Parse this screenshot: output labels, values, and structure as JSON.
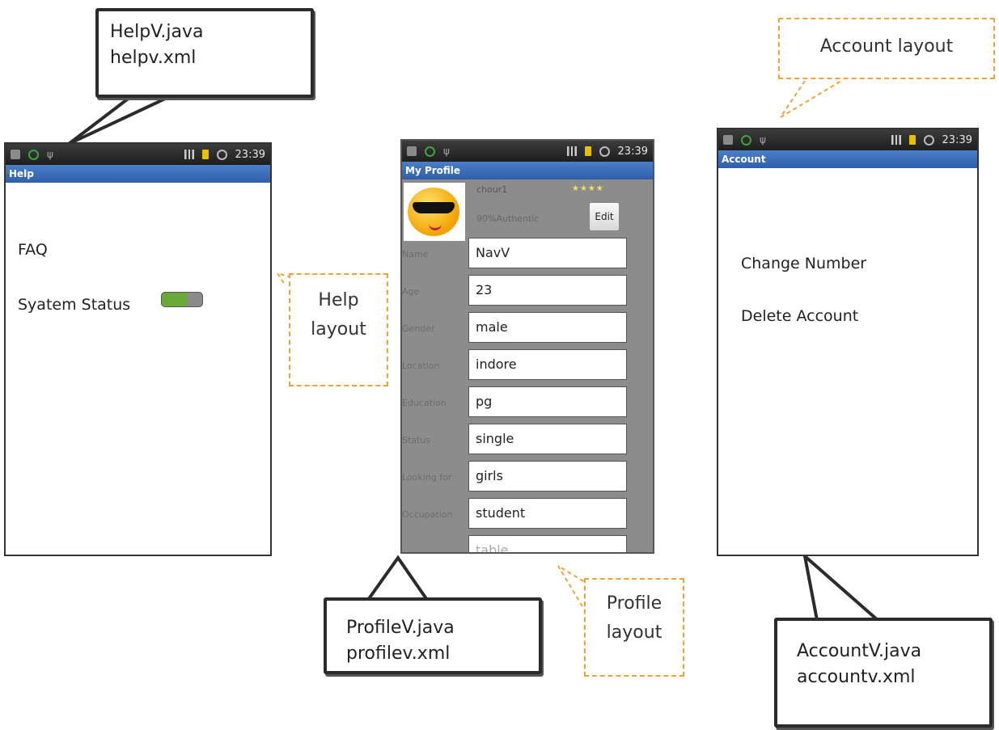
{
  "callouts": {
    "help": [
      "HelpV.java",
      "helpv.xml"
    ],
    "profile": [
      "ProfileV.java",
      "profilev.xml"
    ],
    "account": [
      "AccountV.java",
      "accountv.xml"
    ]
  },
  "notes": {
    "help": [
      "Help",
      "layout"
    ],
    "profile": [
      "Profile",
      "layout"
    ],
    "account": "Account layout"
  },
  "statusbar": {
    "time": "23:39"
  },
  "help_screen": {
    "title": "Help",
    "items": [
      "FAQ",
      "Syatem Status"
    ]
  },
  "profile_screen": {
    "title": "My Profile",
    "user": "chour1",
    "authenticity": "90%Authentic",
    "stars": "★★★★",
    "edit_label": "Edit",
    "fields": [
      {
        "label": "Name",
        "value": "NavV"
      },
      {
        "label": "Age",
        "value": "23"
      },
      {
        "label": "Gender",
        "value": "male"
      },
      {
        "label": "Location",
        "value": "indore"
      },
      {
        "label": "Education",
        "value": "pg"
      },
      {
        "label": "Status",
        "value": "single"
      },
      {
        "label": "Looking for",
        "value": "girls"
      },
      {
        "label": "Occupation",
        "value": "student"
      }
    ],
    "partial_field_value": "table"
  },
  "account_screen": {
    "title": "Account",
    "items": [
      "Change Number",
      "Delete Account"
    ]
  },
  "colors": {
    "title_bar": "#3a6fbf",
    "note_border": "#f0a23a",
    "toggle_on": "#6aa83a"
  }
}
